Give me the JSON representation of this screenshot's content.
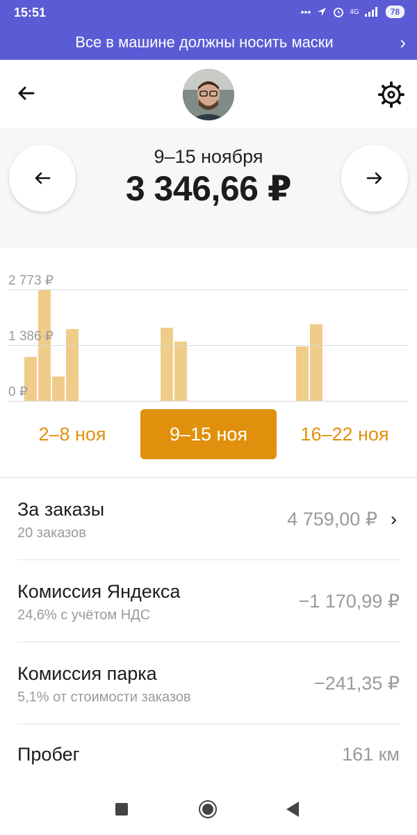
{
  "status_bar": {
    "time": "15:51",
    "icons": [
      "dots-icon",
      "location-icon",
      "alarm-icon",
      "signal-4g-icon",
      "signal-icon"
    ],
    "battery": "78",
    "network": "4G"
  },
  "banner": {
    "text": "Все в машине должны носить маски"
  },
  "summary": {
    "period": "9–15 ноября",
    "total": "3 346,66 ₽"
  },
  "chart_data": {
    "type": "bar",
    "y_ticks": [
      "2 773 ₽",
      "1 386 ₽",
      "0 ₽"
    ],
    "ylim": [
      0,
      2773
    ],
    "weeks": [
      {
        "label": "2–8 ноя",
        "values": [
          1090,
          2773,
          600,
          1780
        ]
      },
      {
        "label": "9–15 ноя",
        "values": [
          1820,
          1480
        ]
      },
      {
        "label": "16–22 ноя",
        "values": [
          1360,
          1900
        ]
      }
    ],
    "selected_week": "9–15 ноя",
    "bar_color": "#f0cc8a",
    "accent_color": "#e0900c"
  },
  "rows": [
    {
      "title": "За заказы",
      "subtitle": "20 заказов",
      "value": "4 759,00 ₽",
      "chevron": "›"
    },
    {
      "title": "Комиссия Яндекса",
      "subtitle": "24,6% с учётом НДС",
      "value": "−1 170,99 ₽"
    },
    {
      "title": "Комиссия парка",
      "subtitle": "5,1% от стоимости заказов",
      "value": "−241,35 ₽"
    },
    {
      "title": "Пробег",
      "subtitle": "",
      "value": "161 км"
    }
  ],
  "colors": {
    "banner": "#5b5bd6",
    "accent": "#e0900c",
    "bar": "#f0cc8a",
    "secondary_text": "#9a9a9a"
  }
}
